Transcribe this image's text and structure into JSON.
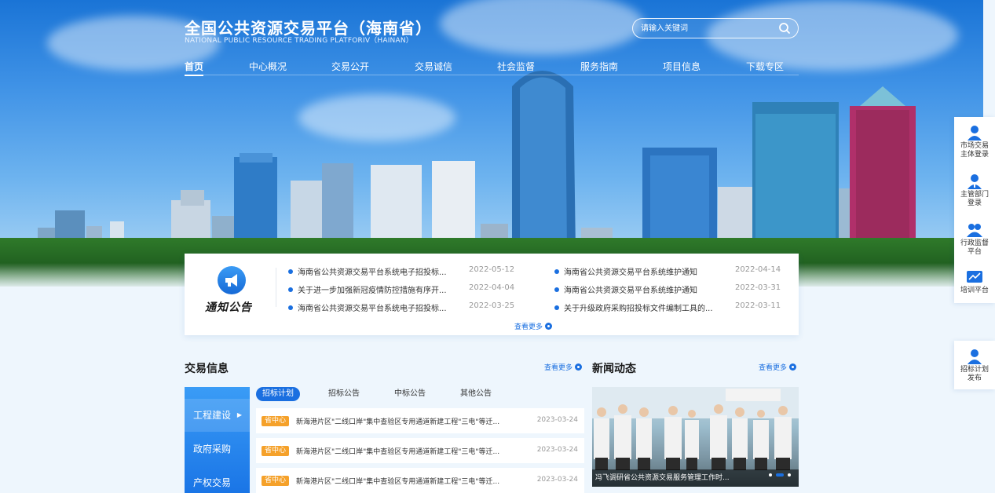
{
  "header": {
    "title": "全国公共资源交易平台（海南省）",
    "subtitle": "NATIONAL PUBLIC RESOURCE TRADING PLATFORIV（HAINAN）"
  },
  "search": {
    "placeholder": "请输入关键词",
    "icon": "search-icon"
  },
  "nav": [
    {
      "label": "首页",
      "active": true
    },
    {
      "label": "中心概况"
    },
    {
      "label": "交易公开"
    },
    {
      "label": "交易诚信"
    },
    {
      "label": "社会监督"
    },
    {
      "label": "服务指南"
    },
    {
      "label": "项目信息"
    },
    {
      "label": "下载专区"
    }
  ],
  "notice": {
    "title": "通知公告",
    "icon": "megaphone-icon",
    "more": "查看更多",
    "items": [
      {
        "text": "海南省公共资源交易平台系统电子招投标...",
        "date": "2022-05-12"
      },
      {
        "text": "海南省公共资源交易平台系统维护通知",
        "date": "2022-04-14"
      },
      {
        "text": "关于进一步加强新冠疫情防控措施有序开...",
        "date": "2022-04-04"
      },
      {
        "text": "海南省公共资源交易平台系统维护通知",
        "date": "2022-03-31"
      },
      {
        "text": "海南省公共资源交易平台系统电子招投标...",
        "date": "2022-03-25"
      },
      {
        "text": "关于升级政府采购招投标文件编制工具的...",
        "date": "2022-03-11"
      }
    ]
  },
  "trade": {
    "title": "交易信息",
    "more": "查看更多",
    "categories": [
      {
        "label": "工程建设",
        "active": true
      },
      {
        "label": "政府采购"
      },
      {
        "label": "产权交易"
      }
    ],
    "tabs": [
      {
        "label": "招标计划",
        "active": true
      },
      {
        "label": "招标公告"
      },
      {
        "label": "中标公告"
      },
      {
        "label": "其他公告"
      }
    ],
    "rows": [
      {
        "badge": "省中心",
        "title": "新海港片区\"二线口岸\"集中查验区专用通道新建工程\"三电\"等迁...",
        "date": "2023-03-24"
      },
      {
        "badge": "省中心",
        "title": "新海港片区\"二线口岸\"集中查验区专用通道新建工程\"三电\"等迁...",
        "date": "2023-03-24"
      },
      {
        "badge": "省中心",
        "title": "新海港片区\"二线口岸\"集中查验区专用通道新建工程\"三电\"等迁...",
        "date": "2023-03-24"
      }
    ]
  },
  "news": {
    "title": "新闻动态",
    "more": "查看更多",
    "caption": "冯飞调研省公共资源交易服务管理工作时..."
  },
  "float_panel": [
    {
      "label": "市场交易主体登录",
      "lines": [
        "市场交易",
        "主体登录"
      ],
      "icon": "user-icon"
    },
    {
      "label": "主管部门登录",
      "lines": [
        "主管部门",
        "登录"
      ],
      "icon": "admin-user-icon"
    },
    {
      "label": "行政监督平台",
      "lines": [
        "行政监督",
        "平台"
      ],
      "icon": "supervision-icon"
    },
    {
      "label": "培训平台",
      "lines": [
        "培训平台"
      ],
      "icon": "chart-icon"
    }
  ],
  "float_panel2": [
    {
      "label": "招标计划发布",
      "lines": [
        "招标计划",
        "发布"
      ],
      "icon": "user-icon"
    }
  ],
  "colors": {
    "primary": "#1a6fe0",
    "badge": "#f5a12a",
    "sky_top": "#1a74d6"
  }
}
